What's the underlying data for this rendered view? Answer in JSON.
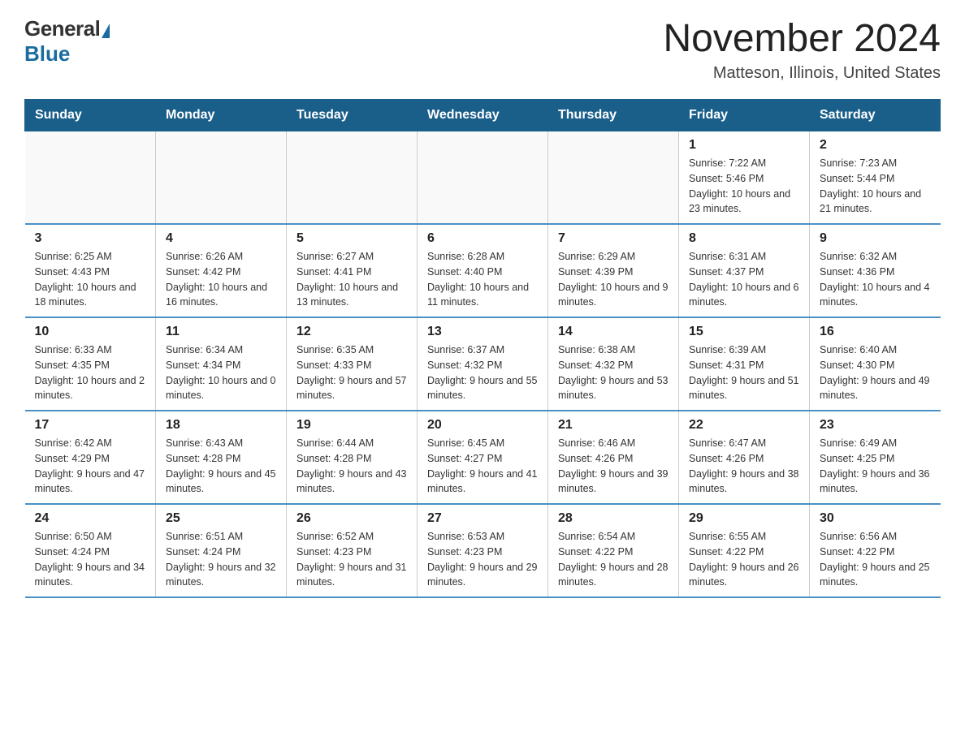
{
  "logo": {
    "general": "General",
    "blue": "Blue"
  },
  "title": "November 2024",
  "location": "Matteson, Illinois, United States",
  "days_of_week": [
    "Sunday",
    "Monday",
    "Tuesday",
    "Wednesday",
    "Thursday",
    "Friday",
    "Saturday"
  ],
  "weeks": [
    [
      {
        "day": "",
        "info": ""
      },
      {
        "day": "",
        "info": ""
      },
      {
        "day": "",
        "info": ""
      },
      {
        "day": "",
        "info": ""
      },
      {
        "day": "",
        "info": ""
      },
      {
        "day": "1",
        "info": "Sunrise: 7:22 AM\nSunset: 5:46 PM\nDaylight: 10 hours and 23 minutes."
      },
      {
        "day": "2",
        "info": "Sunrise: 7:23 AM\nSunset: 5:44 PM\nDaylight: 10 hours and 21 minutes."
      }
    ],
    [
      {
        "day": "3",
        "info": "Sunrise: 6:25 AM\nSunset: 4:43 PM\nDaylight: 10 hours and 18 minutes."
      },
      {
        "day": "4",
        "info": "Sunrise: 6:26 AM\nSunset: 4:42 PM\nDaylight: 10 hours and 16 minutes."
      },
      {
        "day": "5",
        "info": "Sunrise: 6:27 AM\nSunset: 4:41 PM\nDaylight: 10 hours and 13 minutes."
      },
      {
        "day": "6",
        "info": "Sunrise: 6:28 AM\nSunset: 4:40 PM\nDaylight: 10 hours and 11 minutes."
      },
      {
        "day": "7",
        "info": "Sunrise: 6:29 AM\nSunset: 4:39 PM\nDaylight: 10 hours and 9 minutes."
      },
      {
        "day": "8",
        "info": "Sunrise: 6:31 AM\nSunset: 4:37 PM\nDaylight: 10 hours and 6 minutes."
      },
      {
        "day": "9",
        "info": "Sunrise: 6:32 AM\nSunset: 4:36 PM\nDaylight: 10 hours and 4 minutes."
      }
    ],
    [
      {
        "day": "10",
        "info": "Sunrise: 6:33 AM\nSunset: 4:35 PM\nDaylight: 10 hours and 2 minutes."
      },
      {
        "day": "11",
        "info": "Sunrise: 6:34 AM\nSunset: 4:34 PM\nDaylight: 10 hours and 0 minutes."
      },
      {
        "day": "12",
        "info": "Sunrise: 6:35 AM\nSunset: 4:33 PM\nDaylight: 9 hours and 57 minutes."
      },
      {
        "day": "13",
        "info": "Sunrise: 6:37 AM\nSunset: 4:32 PM\nDaylight: 9 hours and 55 minutes."
      },
      {
        "day": "14",
        "info": "Sunrise: 6:38 AM\nSunset: 4:32 PM\nDaylight: 9 hours and 53 minutes."
      },
      {
        "day": "15",
        "info": "Sunrise: 6:39 AM\nSunset: 4:31 PM\nDaylight: 9 hours and 51 minutes."
      },
      {
        "day": "16",
        "info": "Sunrise: 6:40 AM\nSunset: 4:30 PM\nDaylight: 9 hours and 49 minutes."
      }
    ],
    [
      {
        "day": "17",
        "info": "Sunrise: 6:42 AM\nSunset: 4:29 PM\nDaylight: 9 hours and 47 minutes."
      },
      {
        "day": "18",
        "info": "Sunrise: 6:43 AM\nSunset: 4:28 PM\nDaylight: 9 hours and 45 minutes."
      },
      {
        "day": "19",
        "info": "Sunrise: 6:44 AM\nSunset: 4:28 PM\nDaylight: 9 hours and 43 minutes."
      },
      {
        "day": "20",
        "info": "Sunrise: 6:45 AM\nSunset: 4:27 PM\nDaylight: 9 hours and 41 minutes."
      },
      {
        "day": "21",
        "info": "Sunrise: 6:46 AM\nSunset: 4:26 PM\nDaylight: 9 hours and 39 minutes."
      },
      {
        "day": "22",
        "info": "Sunrise: 6:47 AM\nSunset: 4:26 PM\nDaylight: 9 hours and 38 minutes."
      },
      {
        "day": "23",
        "info": "Sunrise: 6:49 AM\nSunset: 4:25 PM\nDaylight: 9 hours and 36 minutes."
      }
    ],
    [
      {
        "day": "24",
        "info": "Sunrise: 6:50 AM\nSunset: 4:24 PM\nDaylight: 9 hours and 34 minutes."
      },
      {
        "day": "25",
        "info": "Sunrise: 6:51 AM\nSunset: 4:24 PM\nDaylight: 9 hours and 32 minutes."
      },
      {
        "day": "26",
        "info": "Sunrise: 6:52 AM\nSunset: 4:23 PM\nDaylight: 9 hours and 31 minutes."
      },
      {
        "day": "27",
        "info": "Sunrise: 6:53 AM\nSunset: 4:23 PM\nDaylight: 9 hours and 29 minutes."
      },
      {
        "day": "28",
        "info": "Sunrise: 6:54 AM\nSunset: 4:22 PM\nDaylight: 9 hours and 28 minutes."
      },
      {
        "day": "29",
        "info": "Sunrise: 6:55 AM\nSunset: 4:22 PM\nDaylight: 9 hours and 26 minutes."
      },
      {
        "day": "30",
        "info": "Sunrise: 6:56 AM\nSunset: 4:22 PM\nDaylight: 9 hours and 25 minutes."
      }
    ]
  ]
}
